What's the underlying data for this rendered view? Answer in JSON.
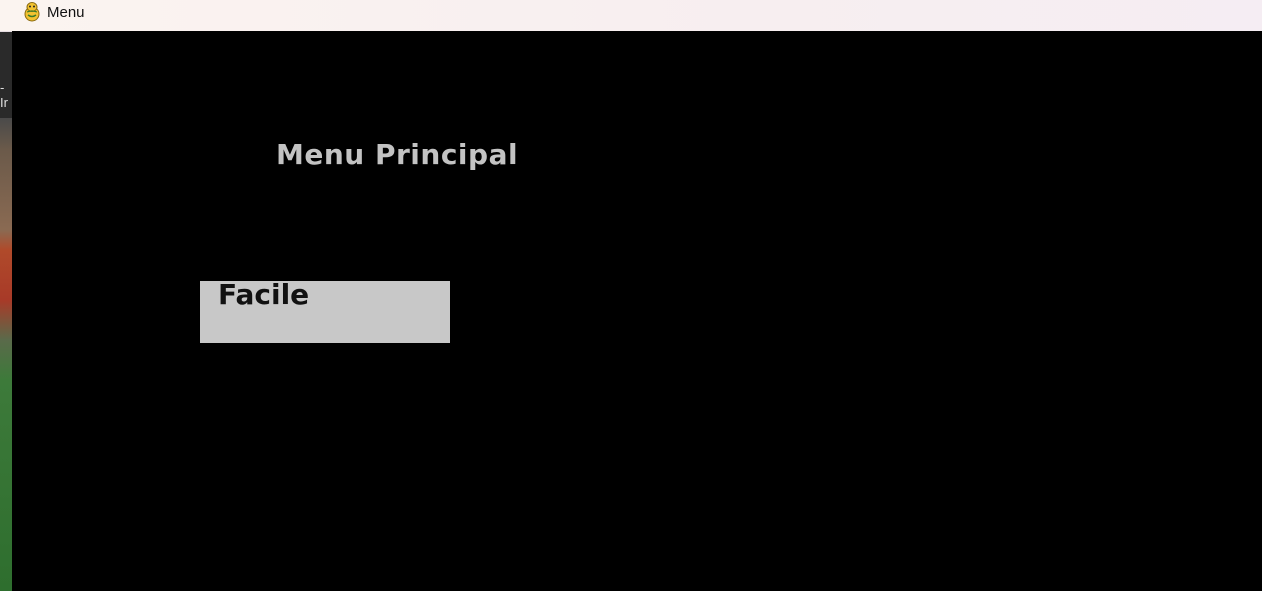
{
  "window": {
    "title": "Menu",
    "icon": "pygame-snake-icon"
  },
  "desktop": {
    "fragment_text": "-Ir"
  },
  "menu": {
    "heading": "Menu Principal",
    "buttons": [
      {
        "label": "Facile"
      }
    ]
  },
  "colors": {
    "canvas_background": "#000000",
    "heading_text": "#c3c3c3",
    "button_background": "#c8c8c8",
    "button_text": "#111111"
  }
}
